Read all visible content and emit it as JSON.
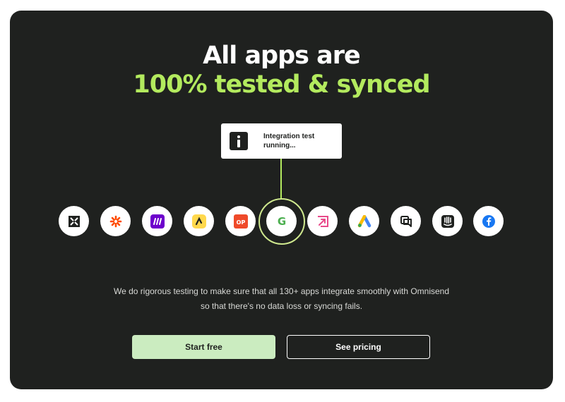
{
  "headline": {
    "line1": "All apps are",
    "line2": "100% tested & synced"
  },
  "toast": {
    "icon": "integration-logo-icon",
    "text": "Integration test running..."
  },
  "apps": [
    {
      "name": "app-icon-1",
      "color": "#1f211f"
    },
    {
      "name": "app-icon-zapier",
      "color": "#ff4a00"
    },
    {
      "name": "app-icon-make",
      "color": "#6d00cc"
    },
    {
      "name": "app-icon-yellow",
      "color": "#ffd84d"
    },
    {
      "name": "app-icon-op",
      "color": "#ef4a2a"
    },
    {
      "name": "app-icon-g",
      "color": "#4caf50"
    },
    {
      "name": "app-icon-arrow",
      "color": "#e84a8a"
    },
    {
      "name": "app-icon-google-ads",
      "color": "#4285f4"
    },
    {
      "name": "app-icon-chat",
      "color": "#1f211f"
    },
    {
      "name": "app-icon-intercom",
      "color": "#1f211f"
    },
    {
      "name": "app-icon-facebook",
      "color": "#1877f2"
    }
  ],
  "description": {
    "line1": "We do rigorous testing to make sure that all 130+ apps integrate smoothly with Omnisend",
    "line2": "so that there's no data loss or syncing fails."
  },
  "buttons": {
    "start": "Start free",
    "pricing": "See pricing"
  },
  "colors": {
    "background": "#1f211f",
    "accent": "#b3ea5e",
    "primary_button": "#cbecc0"
  }
}
